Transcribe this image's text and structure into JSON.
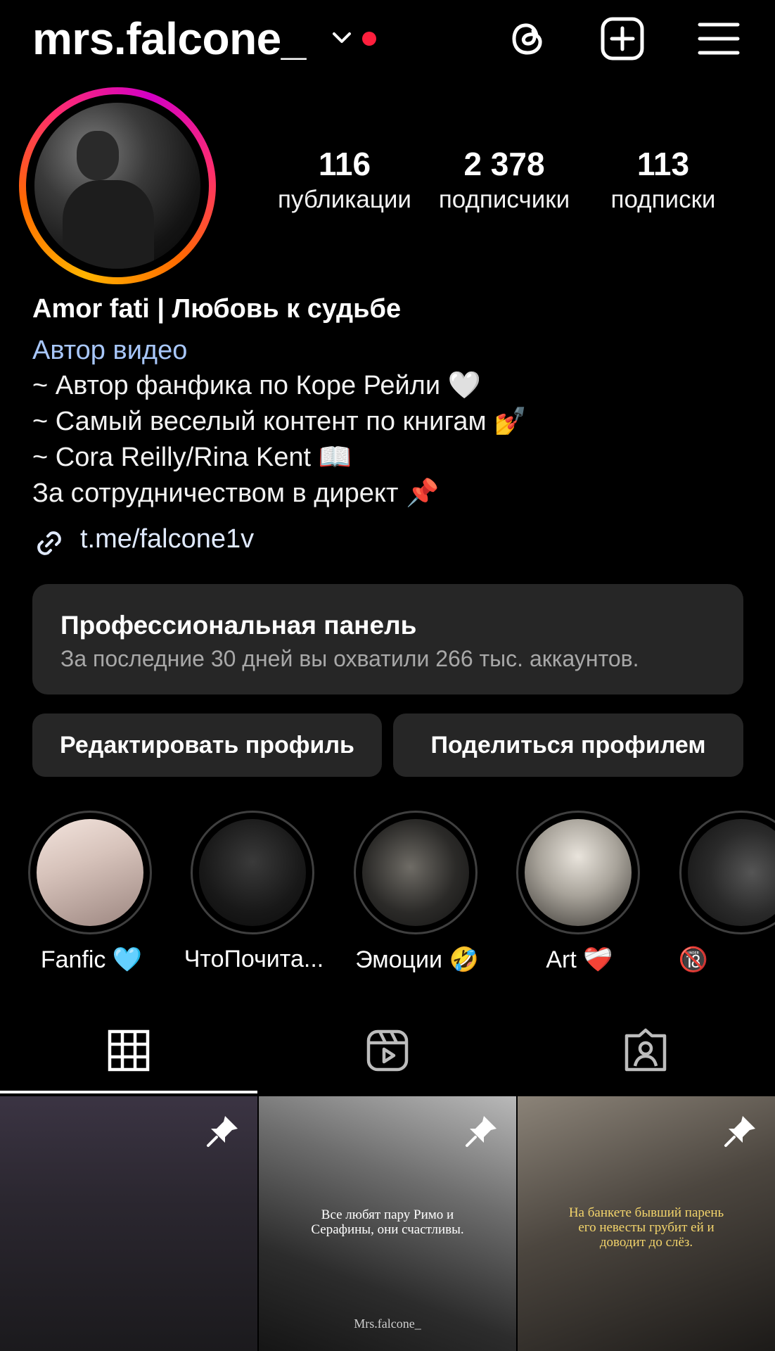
{
  "header": {
    "username": "mrs.falcone_",
    "icons": [
      "chevron-down-icon",
      "notification-dot",
      "threads-icon",
      "add-post-icon",
      "menu-icon"
    ]
  },
  "stats": {
    "posts": {
      "value": "116",
      "label": "публикации"
    },
    "followers": {
      "value": "2 378",
      "label": "подписчики"
    },
    "following": {
      "value": "113",
      "label": "подписки"
    }
  },
  "bio": {
    "name": "Amor fati | Любовь к судьбе",
    "category": "Автор видео",
    "lines": [
      "~ Автор фанфика по Коре Рейли 🤍",
      "~ Самый веселый контент по книгам 💅",
      "~ Cora Reilly/Rina Kent 📖",
      "За сотрудничеством в директ 📌"
    ],
    "link": "t.me/falcone1v"
  },
  "pro_panel": {
    "title": "Профессиональная панель",
    "subtitle": "За последние 30 дней вы охватили 266 тыс. аккаунтов."
  },
  "buttons": {
    "edit": "Редактировать профиль",
    "share": "Поделиться профилем"
  },
  "highlights": [
    {
      "label": "Fanfic 🩵"
    },
    {
      "label": "ЧтоПочита..."
    },
    {
      "label": "Эмоции 🤣"
    },
    {
      "label": "Art ❤️‍🩹"
    },
    {
      "label": "🔞"
    }
  ],
  "tabs": [
    "grid-icon",
    "reels-icon",
    "tagged-icon"
  ],
  "posts": [
    {
      "caption": "",
      "watermark": ""
    },
    {
      "caption": "Все любят пару Римо и Серафины, они счастливы.",
      "watermark": "Mrs.falcone_"
    },
    {
      "caption": "На банкете бывший парень его невесты грубит ей и доводит до слёз.",
      "watermark": ""
    }
  ],
  "colors": {
    "background": "#000000",
    "panel": "#262626",
    "link": "#a8c7fa",
    "notification": "#ff1f3d",
    "caption_gold": "#f3d46b"
  }
}
